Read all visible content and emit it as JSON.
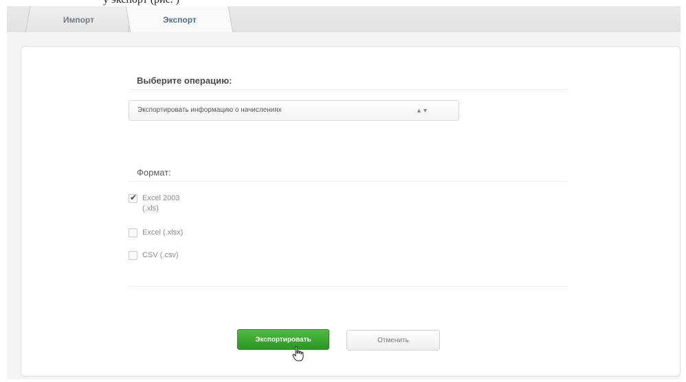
{
  "caption": "у экспорт (рис. )",
  "tabs": [
    {
      "label": "Импорт"
    },
    {
      "label": "Экспорт"
    }
  ],
  "operation": {
    "label": "Выберите операцию:",
    "selected": "Экспортировать информацию о начислениях"
  },
  "format": {
    "label": "Формат:",
    "options": [
      {
        "line1": "Excel 2003",
        "line2": "(.xls)",
        "checked": true
      },
      {
        "line1": "Excel (.xlsx)",
        "line2": "",
        "checked": false
      },
      {
        "line1": "CSV (.csv)",
        "line2": "",
        "checked": false
      }
    ]
  },
  "buttons": {
    "export": "Экспортировать",
    "cancel": "Отменить"
  },
  "colors": {
    "primary": "#2f9e28",
    "tab_text": "#4b6f8c"
  },
  "icons": {
    "check": "checkmark-icon",
    "select_arrows": "up-down-arrows-icon",
    "cursor": "hand-pointer-icon"
  }
}
